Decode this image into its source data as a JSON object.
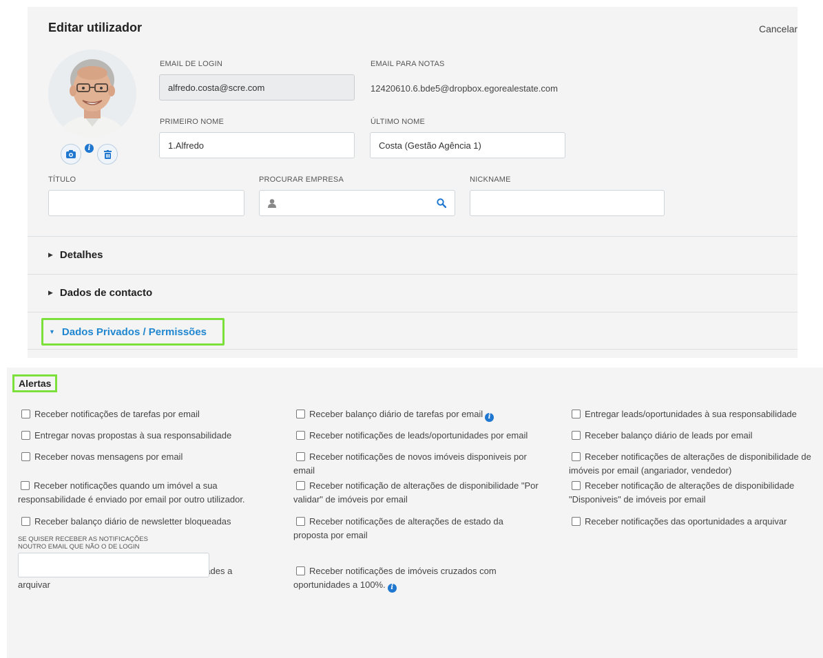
{
  "header": {
    "title": "Editar utilizador",
    "cancel_label": "Cancelar"
  },
  "avatar": {
    "camera_icon": "camera-icon",
    "delete_icon": "trash-icon",
    "info_icon": "info-icon",
    "info_glyph": "i"
  },
  "form": {
    "login_email": {
      "label": "EMAIL DE LOGIN",
      "value": "alfredo.costa@scre.com"
    },
    "notes_email": {
      "label": "EMAIL PARA NOTAS",
      "value": "12420610.6.bde5@dropbox.egorealestate.com"
    },
    "first_name": {
      "label": "PRIMEIRO NOME",
      "value": "1.Alfredo"
    },
    "last_name": {
      "label": "ÚLTIMO NOME",
      "value": "Costa (Gestão Agência 1)"
    },
    "title": {
      "label": "TÍTULO",
      "value": ""
    },
    "company": {
      "label": "PROCURAR EMPRESA",
      "value": "",
      "user_icon": "user-icon",
      "search_icon": "search-icon"
    },
    "nickname": {
      "label": "NICKNAME",
      "value": ""
    }
  },
  "sections": [
    {
      "label": "Detalhes",
      "expanded": false
    },
    {
      "label": "Dados de contacto",
      "expanded": false
    },
    {
      "label": "Dados Privados / Permissões",
      "expanded": true
    }
  ],
  "alerts": {
    "title": "Alertas",
    "info_glyph": "i",
    "items": [
      {
        "label": "Receber notificações de tarefas por email",
        "checked": false
      },
      {
        "label": "Receber balanço diário de tarefas por email",
        "checked": false,
        "info": true
      },
      {
        "label": "Entregar leads/oportunidades à sua responsabilidade",
        "checked": false
      },
      {
        "label": "Entregar novas propostas à sua responsabilidade",
        "checked": false
      },
      {
        "label": "Receber notificações de leads/oportunidades por email",
        "checked": false
      },
      {
        "label": "Receber balanço diário de leads por email",
        "checked": false
      },
      {
        "label": "Receber novas mensagens por email",
        "checked": false
      },
      {
        "label": "Receber notificações de novos imóveis disponiveis por email",
        "checked": false
      },
      {
        "label": "Receber notificações de alterações de disponibilidade de imóveis por email (angariador, vendedor)",
        "checked": false
      },
      {
        "label": "Receber notificações quando um imóvel a sua responsabilidade é enviado por email por outro utilizador.",
        "checked": false
      },
      {
        "label": "Receber notificação de alterações de disponibilidade \"Por validar\" de imóveis por email",
        "checked": false
      },
      {
        "label": "Receber notificação de alterações de disponibilidade \"Disponiveis\" de imóveis por email",
        "checked": false
      },
      {
        "label": "Receber balanço diário de newsletter bloqueadas",
        "checked": false
      },
      {
        "label": "Receber notificações de alterações de estado da proposta por email",
        "checked": false
      },
      {
        "label": "Receber notificações das oportunidades a arquivar",
        "checked": false
      },
      {
        "label": "Receber notificações das minhas oportunidades a arquivar",
        "checked": false
      },
      {
        "label": "Receber notificações de imóveis cruzados com oportunidades a 100%.",
        "checked": false,
        "info": true
      }
    ],
    "alt_email": {
      "label_line1": "SE QUISER RECEBER AS NOTIFICAÇÕES",
      "label_line2": "NOUTRO EMAIL QUE NÃO O DE LOGIN",
      "value": ""
    }
  },
  "colors": {
    "accent": "#1f86cf",
    "highlight": "#7be03a",
    "panel_bg": "#f4f4f5"
  }
}
